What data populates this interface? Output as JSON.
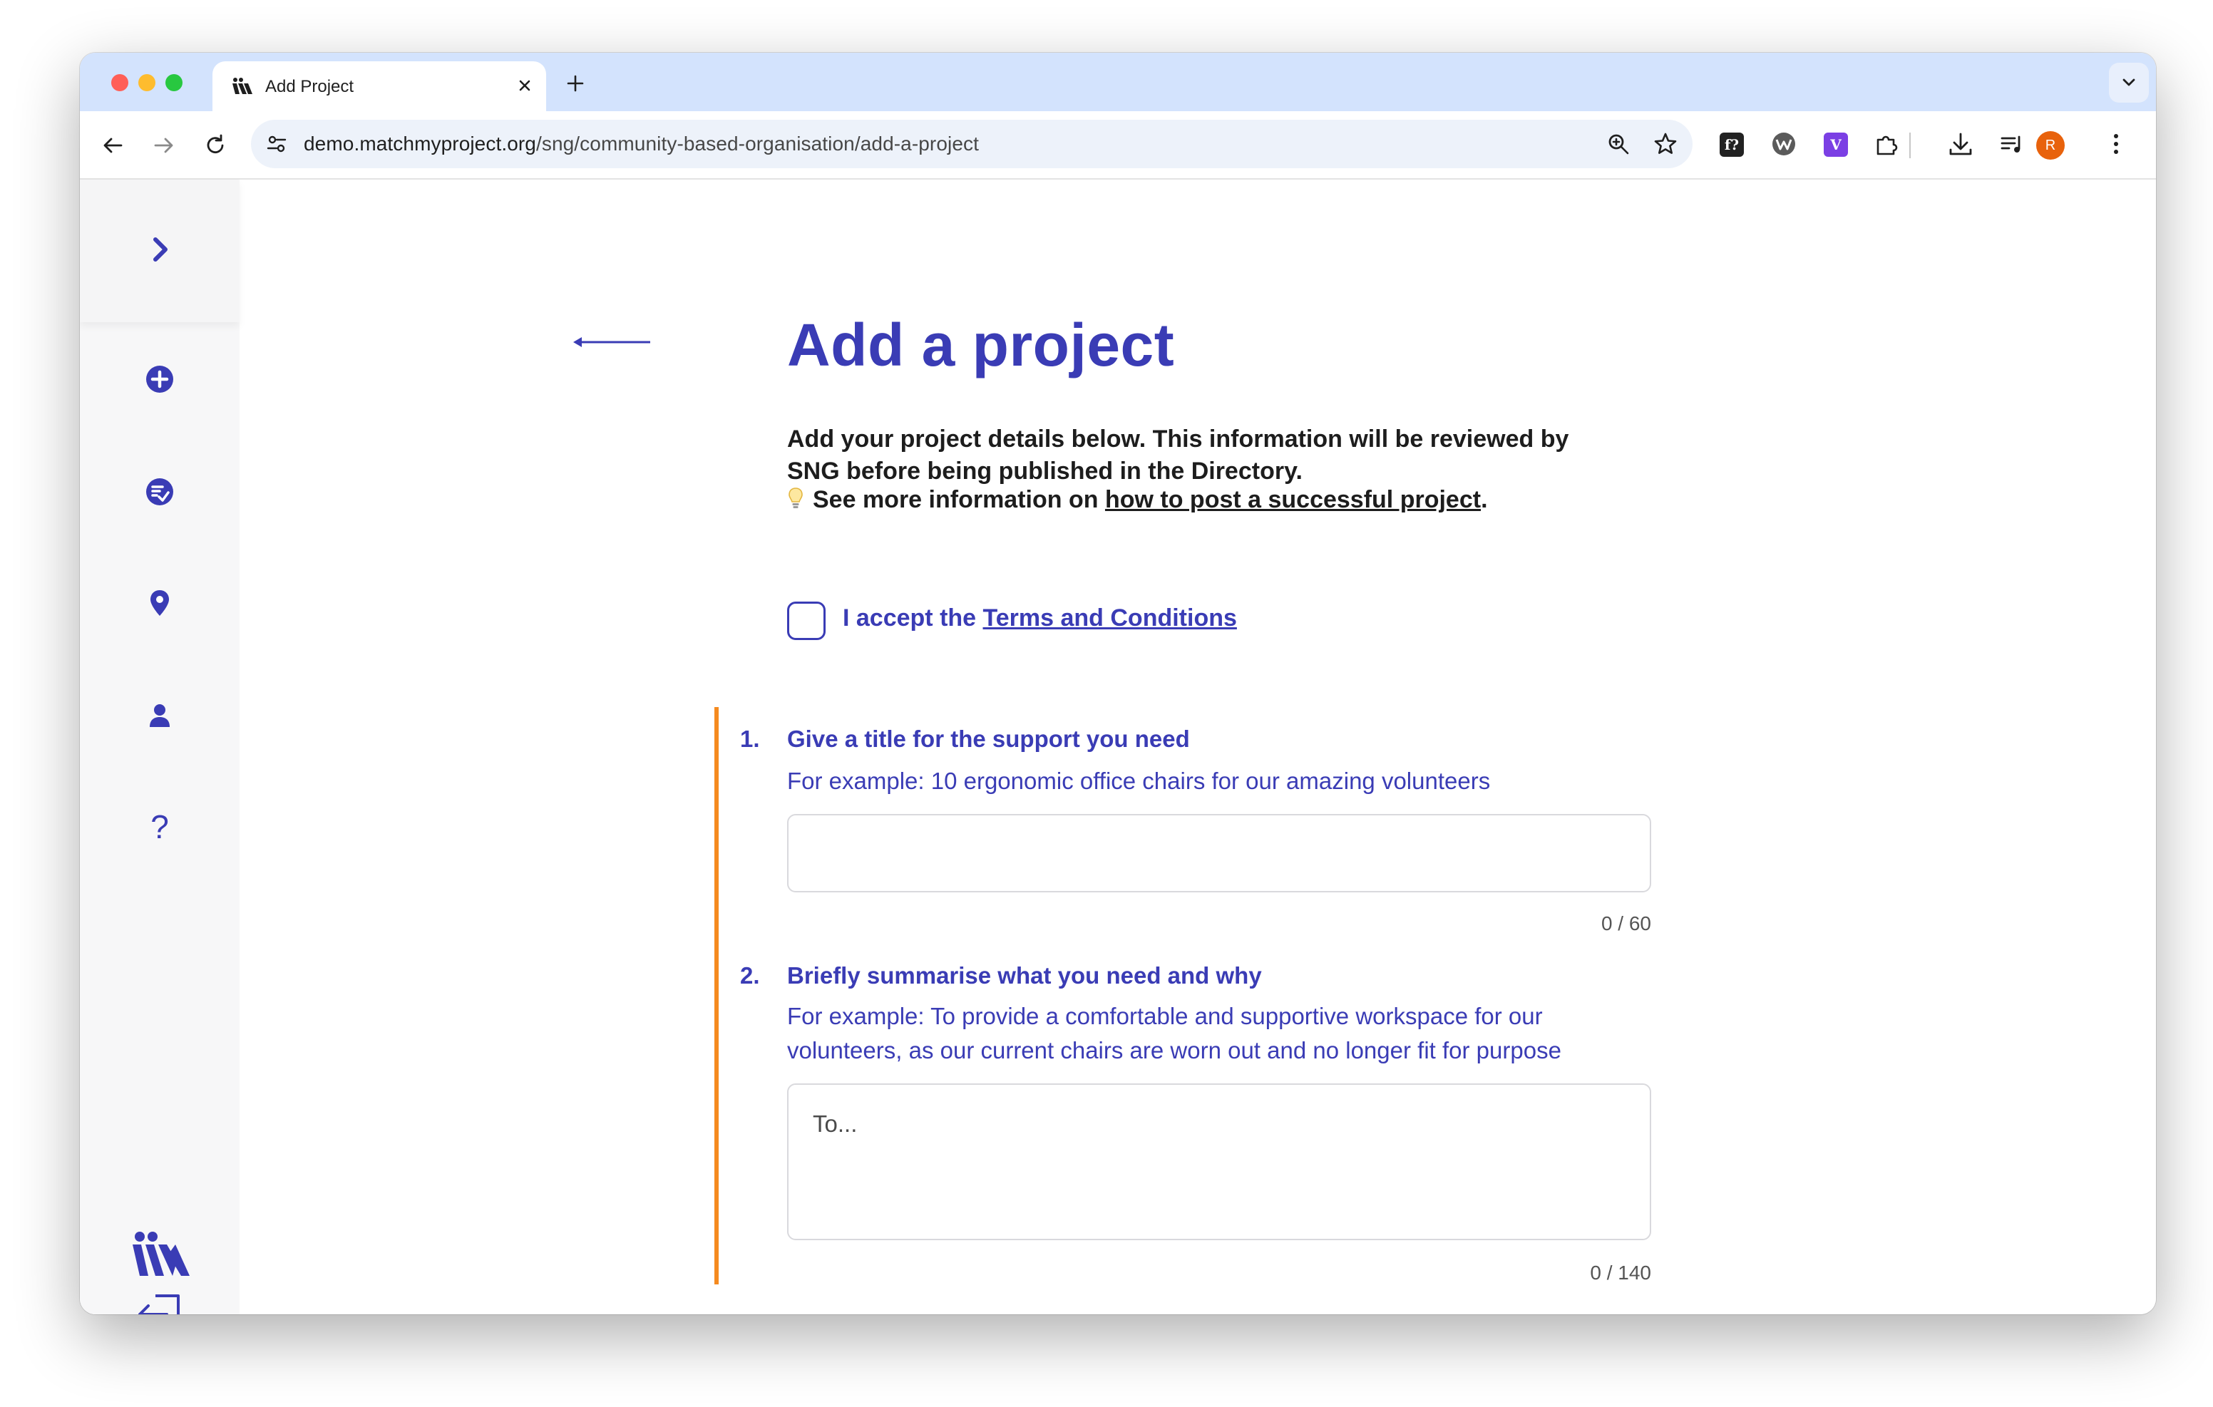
{
  "browser": {
    "tab_title": "Add Project",
    "url_host": "demo.matchmyproject.org",
    "url_path": "/sng/community-based-organisation/add-a-project",
    "avatar_letter": "R",
    "extensions": [
      "fx-extension-icon",
      "wappalyzer-icon",
      "v-extension-icon",
      "puzzle-extensions-icon"
    ]
  },
  "sidebar": {
    "items": [
      {
        "name": "expand-chevron-icon"
      },
      {
        "name": "add-circle-icon"
      },
      {
        "name": "checklist-icon"
      },
      {
        "name": "location-pin-icon"
      },
      {
        "name": "person-icon"
      },
      {
        "name": "help-icon",
        "glyph": "?"
      },
      {
        "name": "logo"
      },
      {
        "name": "logout-icon"
      }
    ]
  },
  "page": {
    "title": "Add a project",
    "intro": "Add your project details below. This information will be reviewed by SNG before being published in the Directory.",
    "tip_prefix": "See more information on ",
    "tip_link": "how to post a successful project",
    "tip_suffix": ".",
    "terms_prefix": "I accept the ",
    "terms_link": "Terms and Conditions"
  },
  "questions": [
    {
      "number": "1.",
      "title": "Give a title for the support you need",
      "hint": "For example: 10 ergonomic office chairs for our amazing volunteers",
      "value": "",
      "placeholder": "",
      "counter": "0 / 60"
    },
    {
      "number": "2.",
      "title": "Briefly summarise what you need and why",
      "hint": "For example: To provide a comfortable and supportive workspace for our volunteers, as our current chairs are worn out and no longer fit for purpose",
      "value": "",
      "placeholder": "To...",
      "counter": "0 / 140"
    }
  ],
  "colors": {
    "accent": "#3a3cb5",
    "orange": "#f58a1f",
    "tabstrip": "#d3e3fd"
  }
}
